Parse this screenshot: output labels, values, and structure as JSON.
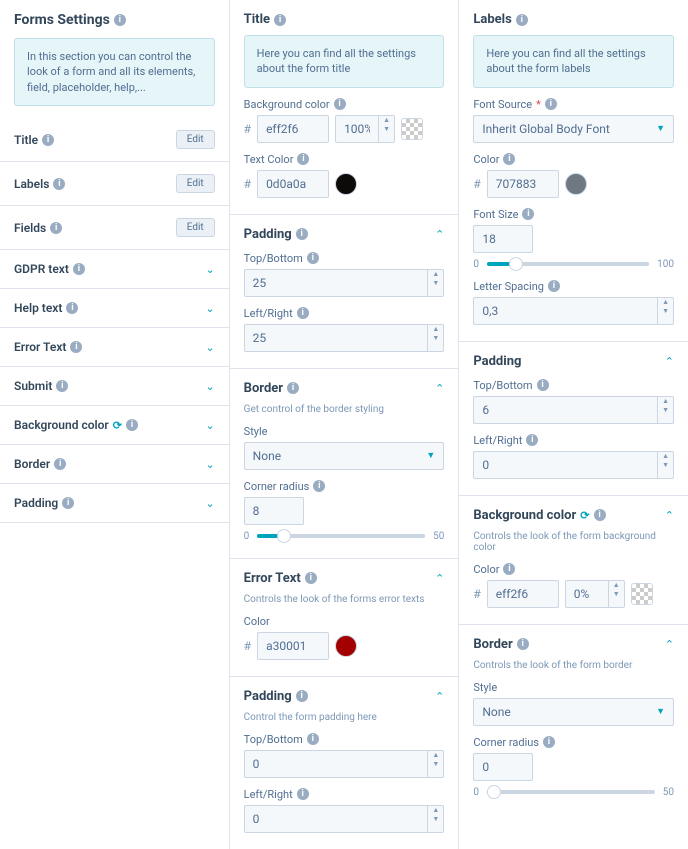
{
  "left": {
    "heading": "Forms Settings",
    "intro": "In this section you can control the look of a form and all its elements, field, placeholder, help,...",
    "edit_label": "Edit",
    "items_edit": [
      {
        "label": "Title"
      },
      {
        "label": "Labels"
      },
      {
        "label": "Fields"
      }
    ],
    "items_expand": [
      {
        "label": "GDPR text"
      },
      {
        "label": "Help text"
      },
      {
        "label": "Error Text"
      },
      {
        "label": "Submit"
      },
      {
        "label": "Background color",
        "sync": true
      },
      {
        "label": "Border"
      },
      {
        "label": "Padding"
      }
    ]
  },
  "mid": {
    "title_section": {
      "heading": "Title",
      "info": "Here you can find all the settings about the form title",
      "bg_label": "Background color",
      "bg_value": "eff2f6",
      "bg_opacity": "100%",
      "txt_label": "Text Color",
      "txt_value": "0d0a0a",
      "txt_swatch": "#0d0a0a"
    },
    "padding1": {
      "heading": "Padding",
      "tb_label": "Top/Bottom",
      "tb_value": "25",
      "lr_label": "Left/Right",
      "lr_value": "25"
    },
    "border": {
      "heading": "Border",
      "desc": "Get control of the border styling",
      "style_label": "Style",
      "style_value": "None",
      "radius_label": "Corner radius",
      "radius_value": "8",
      "slider_min": "0",
      "slider_max": "50",
      "slider_pct": 16
    },
    "error": {
      "heading": "Error Text",
      "desc": "Controls the look of the forms error texts",
      "color_label": "Color",
      "color_value": "a30001",
      "swatch": "#a30001"
    },
    "padding2": {
      "heading": "Padding",
      "desc": "Control the form padding here",
      "tb_label": "Top/Bottom",
      "tb_value": "0",
      "lr_label": "Left/Right",
      "lr_value": "0"
    }
  },
  "right": {
    "labels_section": {
      "heading": "Labels",
      "info": "Here you can find all the settings about the form labels",
      "font_source_label": "Font Source",
      "font_source_value": "Inherit Global Body Font",
      "color_label": "Color",
      "color_value": "707883",
      "swatch": "#707883",
      "size_label": "Font Size",
      "size_value": "18",
      "size_min": "0",
      "size_max": "100",
      "size_pct": 18,
      "spacing_label": "Letter Spacing",
      "spacing_value": "0,3"
    },
    "padding": {
      "heading": "Padding",
      "tb_label": "Top/Bottom",
      "tb_value": "6",
      "lr_label": "Left/Right",
      "lr_value": "0"
    },
    "bg": {
      "heading": "Background color",
      "desc": "Controls the look of the form background color",
      "color_label": "Color",
      "color_value": "eff2f6",
      "opacity": "0%"
    },
    "border": {
      "heading": "Border",
      "desc": "Controls the look of the form border",
      "style_label": "Style",
      "style_value": "None",
      "radius_label": "Corner radius",
      "radius_value": "0",
      "slider_min": "0",
      "slider_max": "50",
      "slider_pct": 4
    }
  }
}
